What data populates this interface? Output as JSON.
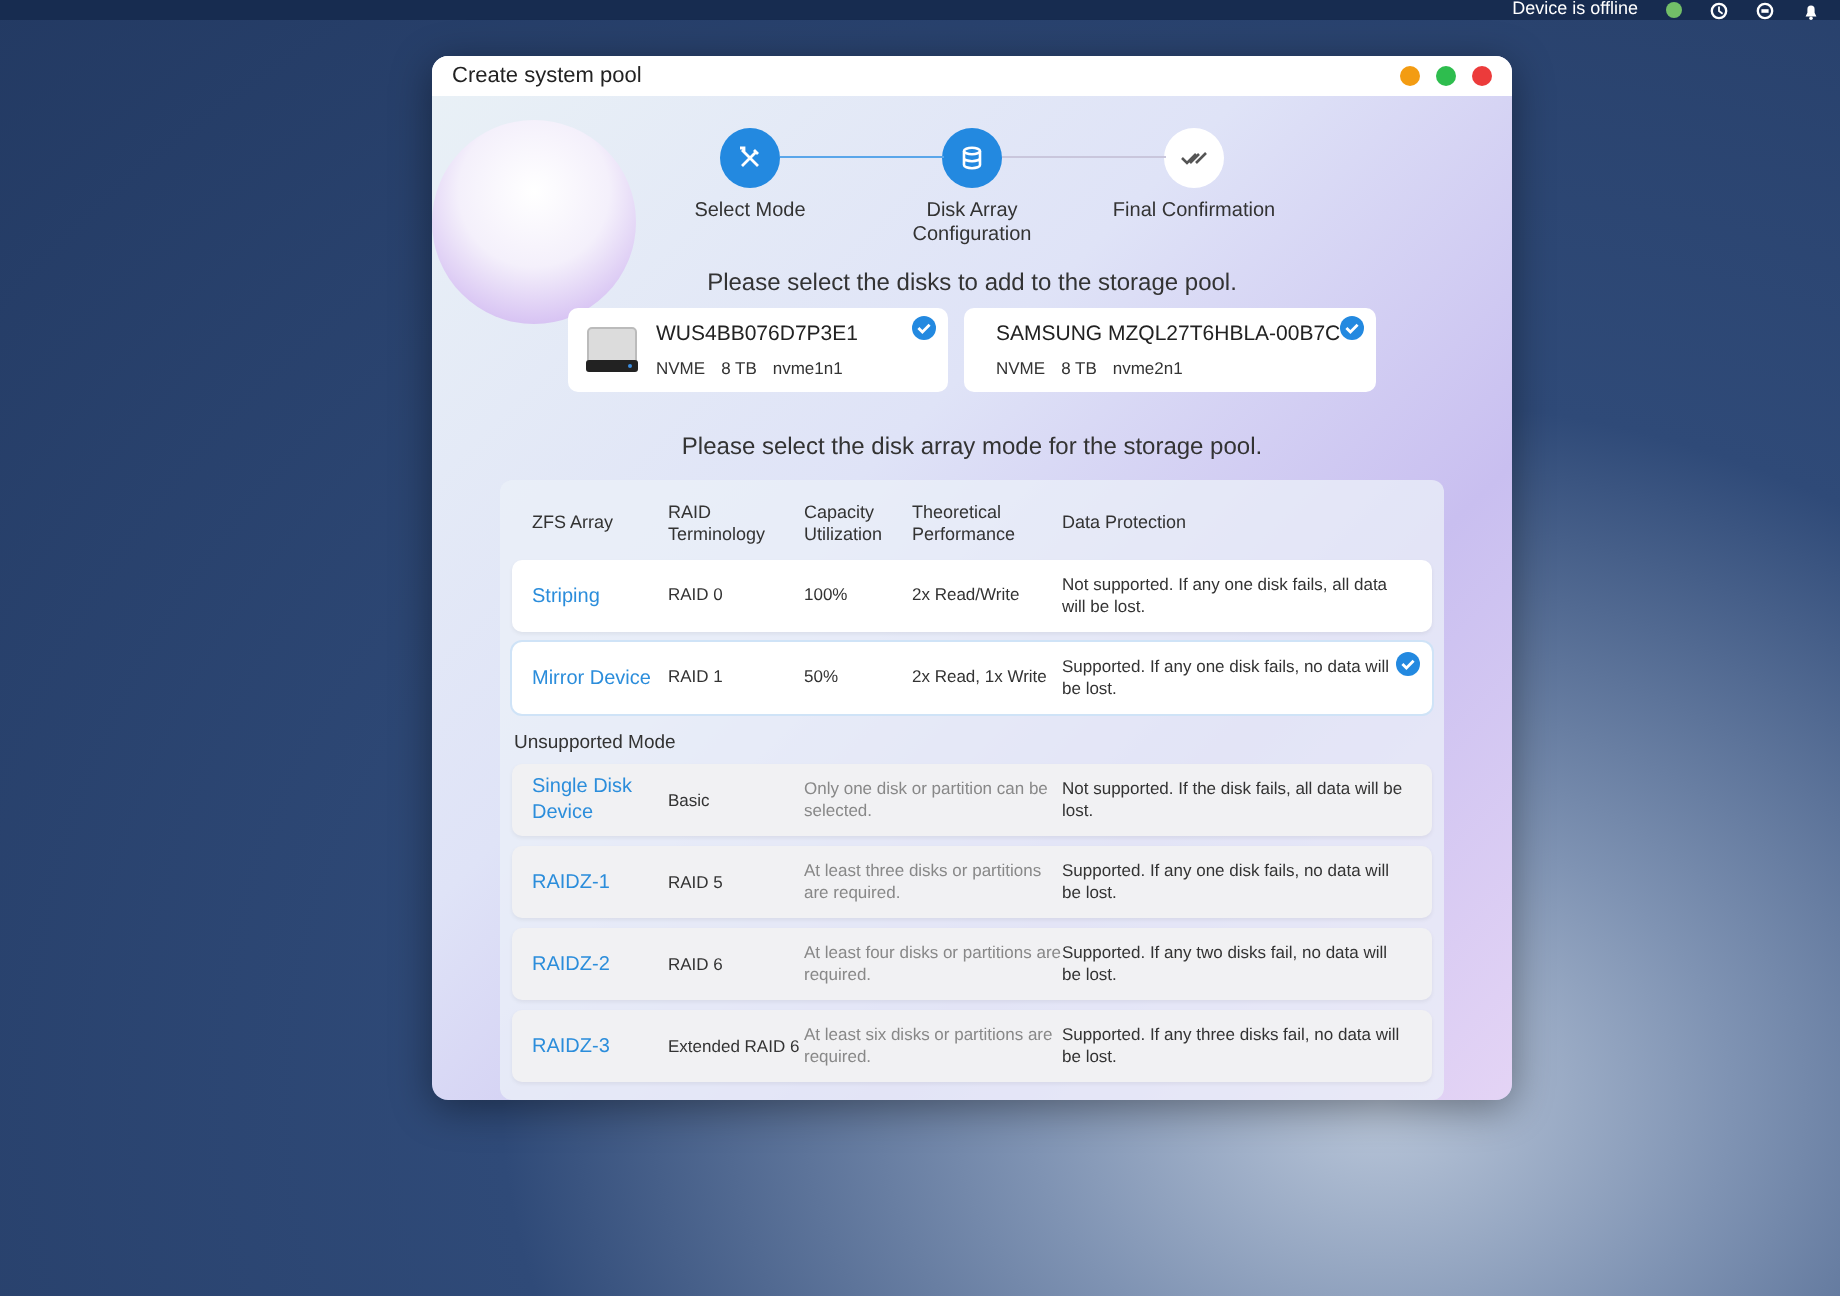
{
  "top_bar": {
    "status": "Device is offline",
    "online": false
  },
  "window": {
    "title": "Create system pool"
  },
  "steps": [
    {
      "label": "Select Mode",
      "active": true,
      "kind": "tools"
    },
    {
      "label": "Disk Array Configuration",
      "active": true,
      "kind": "database"
    },
    {
      "label": "Final Confirmation",
      "active": false,
      "kind": "checks"
    }
  ],
  "disks_prompt": "Please select the disks to add to the storage pool.",
  "disks": [
    {
      "name": "WUS4BB076D7P3E1",
      "type": "NVME",
      "size": "8 TB",
      "device": "nvme1n1",
      "selected": true
    },
    {
      "name": "SAMSUNG MZQL27T6HBLA-00B7C",
      "type": "NVME",
      "size": "8 TB",
      "device": "nvme2n1",
      "selected": true
    }
  ],
  "mode_prompt": "Please select the disk array mode for the storage pool.",
  "table": {
    "columns": [
      "ZFS Array",
      "RAID Terminology",
      "Capacity Utilization",
      "Theoretical Performance",
      "Data Protection"
    ],
    "rows": [
      {
        "kind": "supported",
        "name": "Striping",
        "raid": "RAID 0",
        "capacity": "100%",
        "performance": "2x Read/Write",
        "protection": "Not supported. If any one disk fails, all data will be lost.",
        "selected": false
      },
      {
        "kind": "supported",
        "name": "Mirror Device",
        "raid": "RAID 1",
        "capacity": "50%",
        "performance": "2x Read, 1x Write",
        "protection": "Supported. If any one disk fails, no data will be lost.",
        "selected": true
      }
    ],
    "unsupported_heading": "Unsupported Mode",
    "unsupported_rows": [
      {
        "kind": "unsupported",
        "name": "Single Disk Device",
        "raid": "Basic",
        "requirement": "Only one disk or partition can be selected.",
        "protection": "Not supported. If the disk fails, all data will be lost."
      },
      {
        "kind": "unsupported",
        "name": "RAIDZ-1",
        "raid": "RAID 5",
        "requirement": "At least three disks or partitions are required.",
        "protection": "Supported. If any one disk fails, no data will be lost."
      },
      {
        "kind": "unsupported",
        "name": "RAIDZ-2",
        "raid": "RAID 6",
        "requirement": "At least four disks or partitions are required.",
        "protection": "Supported. If any two disks fail, no data will be lost."
      },
      {
        "kind": "unsupported",
        "name": "RAIDZ-3",
        "raid": "Extended RAID 6",
        "requirement": "At least six disks or partitions are required.",
        "protection": "Supported. If any three disks fail, no data will be lost."
      }
    ]
  }
}
